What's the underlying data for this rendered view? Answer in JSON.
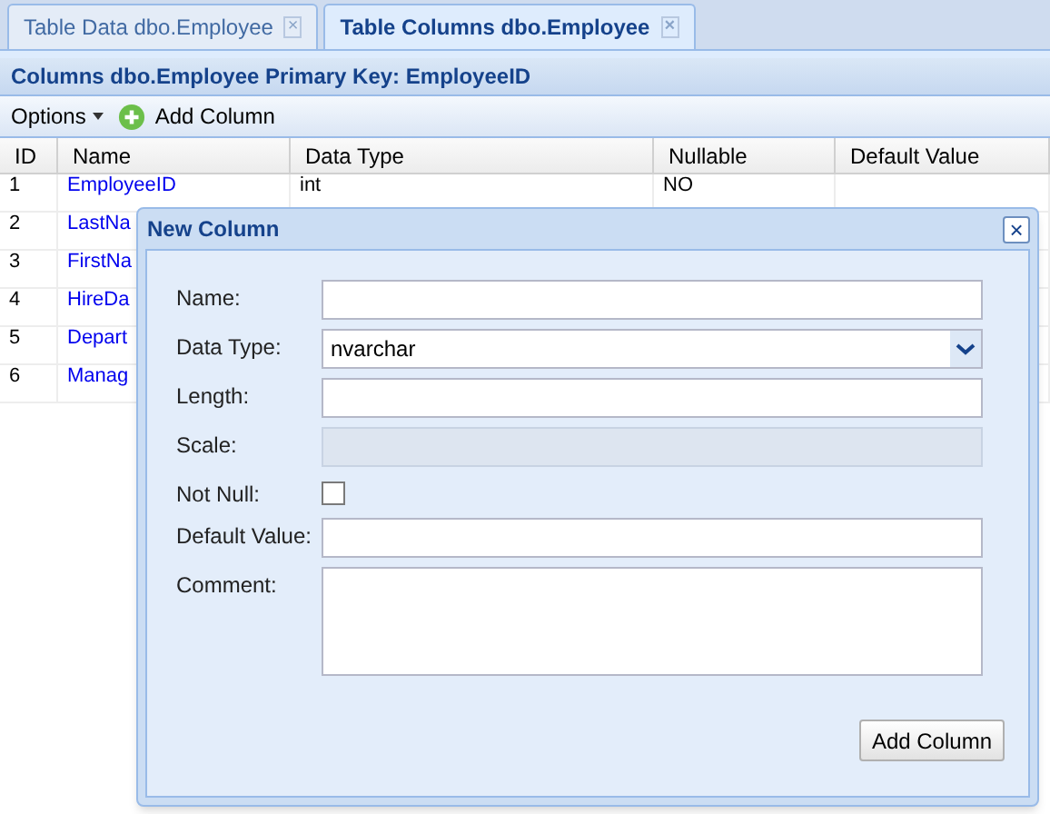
{
  "tabs": [
    {
      "label": "Table Data dbo.Employee",
      "selected": false,
      "close": "×"
    },
    {
      "label": "Table Columns dbo.Employee",
      "selected": true,
      "close": "×"
    }
  ],
  "panel_title": "Columns dbo.Employee Primary Key: EmployeeID",
  "toolbar": {
    "options": "Options",
    "add": "Add Column"
  },
  "table": {
    "columns": [
      "ID",
      "Name",
      "Data Type",
      "Nullable",
      "Default Value"
    ],
    "rows": [
      [
        "1",
        "EmployeeID",
        "int",
        "NO"
      ],
      [
        "2",
        "LastNa"
      ],
      [
        "3",
        "FirstNa"
      ],
      [
        "4",
        "HireDa"
      ],
      [
        "5",
        "Depart"
      ],
      [
        "6",
        "Manag"
      ]
    ]
  },
  "dialog": {
    "title": "New Column",
    "close": "×",
    "fields": [
      {
        "kind": "text",
        "label": "Name:",
        "disabled": false
      },
      {
        "kind": "select",
        "label": "Data Type:",
        "value": "nvarchar"
      },
      {
        "kind": "text",
        "label": "Length:",
        "disabled": false
      },
      {
        "kind": "text",
        "label": "Scale:",
        "disabled": true
      },
      {
        "kind": "checkbox",
        "label": "Not Null:",
        "checked": false
      },
      {
        "kind": "text",
        "label": "Default Value:",
        "disabled": false
      },
      {
        "kind": "textarea",
        "label": "Comment:"
      }
    ],
    "button": "Add Column"
  }
}
